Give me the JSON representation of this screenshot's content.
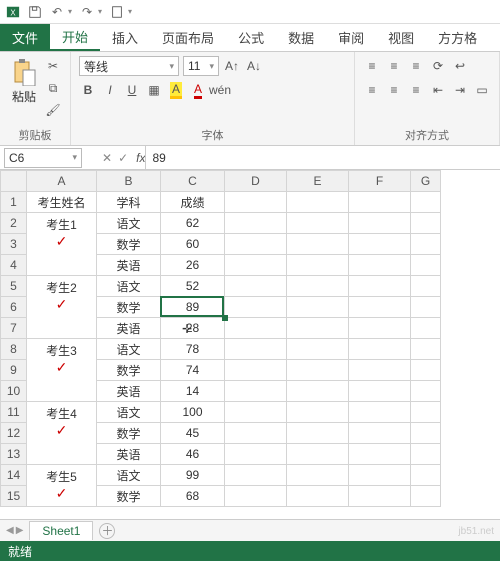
{
  "qat": {
    "save": "保存",
    "undo": "撤销",
    "redo": "恢复",
    "touch": "触摸"
  },
  "tabs": {
    "file": "文件",
    "home": "开始",
    "insert": "插入",
    "layout": "页面布局",
    "formulas": "公式",
    "data": "数据",
    "review": "审阅",
    "view": "视图",
    "addin": "方方格"
  },
  "ribbon": {
    "clipboard": {
      "paste": "粘贴",
      "label": "剪贴板"
    },
    "font": {
      "label": "字体",
      "name": "等线",
      "size": "11",
      "bold": "B",
      "italic": "I",
      "underline": "U"
    },
    "align": {
      "label": "对齐方式"
    }
  },
  "namebox": "C6",
  "formula": "89",
  "columns": [
    "A",
    "B",
    "C",
    "D",
    "E",
    "F",
    "G"
  ],
  "headers": {
    "A": "考生姓名",
    "B": "学科",
    "C": "成绩"
  },
  "rows": [
    {
      "n": 1,
      "A": "考生姓名",
      "B": "学科",
      "C": "成绩"
    },
    {
      "n": 2,
      "A": "",
      "B": "语文",
      "C": "62",
      "mergeStartA": "考生1"
    },
    {
      "n": 3,
      "A": "",
      "B": "数学",
      "C": "60"
    },
    {
      "n": 4,
      "A": "",
      "B": "英语",
      "C": "26"
    },
    {
      "n": 5,
      "A": "",
      "B": "语文",
      "C": "52",
      "mergeStartA": "考生2"
    },
    {
      "n": 6,
      "A": "",
      "B": "数学",
      "C": "89"
    },
    {
      "n": 7,
      "A": "",
      "B": "英语",
      "C": "28"
    },
    {
      "n": 8,
      "A": "",
      "B": "语文",
      "C": "78",
      "mergeStartA": "考生3"
    },
    {
      "n": 9,
      "A": "",
      "B": "数学",
      "C": "74"
    },
    {
      "n": 10,
      "A": "",
      "B": "英语",
      "C": "14"
    },
    {
      "n": 11,
      "A": "",
      "B": "语文",
      "C": "100",
      "mergeStartA": "考生4"
    },
    {
      "n": 12,
      "A": "",
      "B": "数学",
      "C": "45"
    },
    {
      "n": 13,
      "A": "",
      "B": "英语",
      "C": "46"
    },
    {
      "n": 14,
      "A": "",
      "B": "语文",
      "C": "99",
      "mergeStartA": "考生5"
    },
    {
      "n": 15,
      "A": "",
      "B": "数学",
      "C": "68"
    }
  ],
  "merged_names": [
    "考生1",
    "考生2",
    "考生3",
    "考生4",
    "考生5"
  ],
  "sheet": {
    "name": "Sheet1"
  },
  "status": "就绪",
  "selection": {
    "cell": "C6",
    "row": 6,
    "col": "C"
  },
  "watermark": "jb51.net"
}
